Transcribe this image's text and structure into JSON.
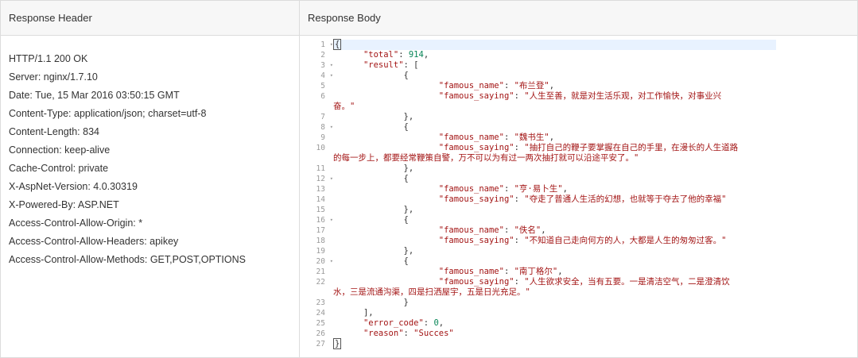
{
  "left": {
    "title": "Response Header",
    "lines": [
      "HTTP/1.1 200 OK",
      "Server: nginx/1.7.10",
      "Date: Tue, 15 Mar 2016 03:50:15 GMT",
      "Content-Type: application/json; charset=utf-8",
      "Content-Length: 834",
      "Connection: keep-alive",
      "Cache-Control: private",
      "X-AspNet-Version: 4.0.30319",
      "X-Powered-By: ASP.NET",
      "Access-Control-Allow-Origin: *",
      "Access-Control-Allow-Headers: apikey",
      "Access-Control-Allow-Methods: GET,POST,OPTIONS"
    ]
  },
  "right": {
    "title": "Response Body",
    "line_numbers": [
      "1",
      "2",
      "3",
      "4",
      "5",
      "6",
      "7",
      "8",
      "9",
      "10",
      "11",
      "12",
      "13",
      "14",
      "15",
      "16",
      "17",
      "18",
      "19",
      "20",
      "21",
      "22",
      "23",
      "24",
      "25",
      "26",
      "27"
    ],
    "fold_lines": [
      "1",
      "3",
      "4",
      "8",
      "12",
      "16",
      "20"
    ],
    "code_rows": [
      {
        "type": "open",
        "text": "{"
      },
      {
        "type": "kv",
        "indent": "      ",
        "key": "\"total\"",
        "val": "914",
        "valtype": "n",
        "tail": ","
      },
      {
        "type": "kv",
        "indent": "      ",
        "key": "\"result\"",
        "val": "[",
        "valtype": "p",
        "tail": ""
      },
      {
        "type": "plain",
        "indent": "              ",
        "text": "{"
      },
      {
        "type": "kv",
        "indent": "                     ",
        "key": "\"famous_name\"",
        "val": "\"布兰登\"",
        "valtype": "s",
        "tail": ","
      },
      {
        "type": "kv",
        "indent": "                     ",
        "key": "\"famous_saying\"",
        "val": "\"人生至善，就是对生活乐观，对工作愉快，对事业兴",
        "valtype": "s",
        "tail": ""
      },
      {
        "type": "cont",
        "indent": "",
        "text": "奋。\""
      },
      {
        "type": "plain",
        "indent": "              ",
        "text": "},"
      },
      {
        "type": "plain",
        "indent": "              ",
        "text": "{"
      },
      {
        "type": "kv",
        "indent": "                     ",
        "key": "\"famous_name\"",
        "val": "\"魏书生\"",
        "valtype": "s",
        "tail": ","
      },
      {
        "type": "kv",
        "indent": "                     ",
        "key": "\"famous_saying\"",
        "val": "\"抽打自己的鞭子要掌握在自己的手里，在漫长的人生道路",
        "valtype": "s",
        "tail": ""
      },
      {
        "type": "cont",
        "indent": "",
        "text": "的每一步上，都要经常鞭策自警，万不可以为有过一两次抽打就可以沿途平安了。\""
      },
      {
        "type": "plain",
        "indent": "              ",
        "text": "},"
      },
      {
        "type": "plain",
        "indent": "              ",
        "text": "{"
      },
      {
        "type": "kv",
        "indent": "                     ",
        "key": "\"famous_name\"",
        "val": "\"亨·易卜生\"",
        "valtype": "s",
        "tail": ","
      },
      {
        "type": "kv",
        "indent": "                     ",
        "key": "\"famous_saying\"",
        "val": "\"夺走了普通人生活的幻想，也就等于夺去了他的幸福\"",
        "valtype": "s",
        "tail": ""
      },
      {
        "type": "plain",
        "indent": "              ",
        "text": "},"
      },
      {
        "type": "plain",
        "indent": "              ",
        "text": "{"
      },
      {
        "type": "kv",
        "indent": "                     ",
        "key": "\"famous_name\"",
        "val": "\"佚名\"",
        "valtype": "s",
        "tail": ","
      },
      {
        "type": "kv",
        "indent": "                     ",
        "key": "\"famous_saying\"",
        "val": "\"不知道自己走向何方的人，大都是人生的匆匆过客。\"",
        "valtype": "s",
        "tail": ""
      },
      {
        "type": "plain",
        "indent": "              ",
        "text": "},"
      },
      {
        "type": "plain",
        "indent": "              ",
        "text": "{"
      },
      {
        "type": "kv",
        "indent": "                     ",
        "key": "\"famous_name\"",
        "val": "\"南丁格尔\"",
        "valtype": "s",
        "tail": ","
      },
      {
        "type": "kv",
        "indent": "                     ",
        "key": "\"famous_saying\"",
        "val": "\"人生欲求安全，当有五要。一是清洁空气，二是澄清饮",
        "valtype": "s",
        "tail": ""
      },
      {
        "type": "cont",
        "indent": "",
        "text": "水，三是流通沟渠，四是扫洒屋宇，五是日光充足。\""
      },
      {
        "type": "plain",
        "indent": "              ",
        "text": "}"
      },
      {
        "type": "plain",
        "indent": "      ",
        "text": "],"
      },
      {
        "type": "kv",
        "indent": "      ",
        "key": "\"error_code\"",
        "val": "0",
        "valtype": "n",
        "tail": ","
      },
      {
        "type": "kv",
        "indent": "      ",
        "key": "\"reason\"",
        "val": "\"Succes\"",
        "valtype": "s",
        "tail": ""
      },
      {
        "type": "close",
        "text": "}"
      }
    ],
    "gutter_map": [
      "1",
      "2",
      "3",
      "4",
      "5",
      "6",
      "",
      "7",
      "8",
      "9",
      "10",
      "",
      "11",
      "12",
      "13",
      "14",
      "15",
      "16",
      "17",
      "18",
      "19",
      "20",
      "21",
      "22",
      "",
      "23",
      "24",
      "25",
      "26",
      "27"
    ]
  },
  "colors": {
    "border": "#dcdcdc",
    "header_bg": "#f7f7f7",
    "string": "#a31515",
    "number": "#098658",
    "highlight": "#e8f2ff"
  }
}
